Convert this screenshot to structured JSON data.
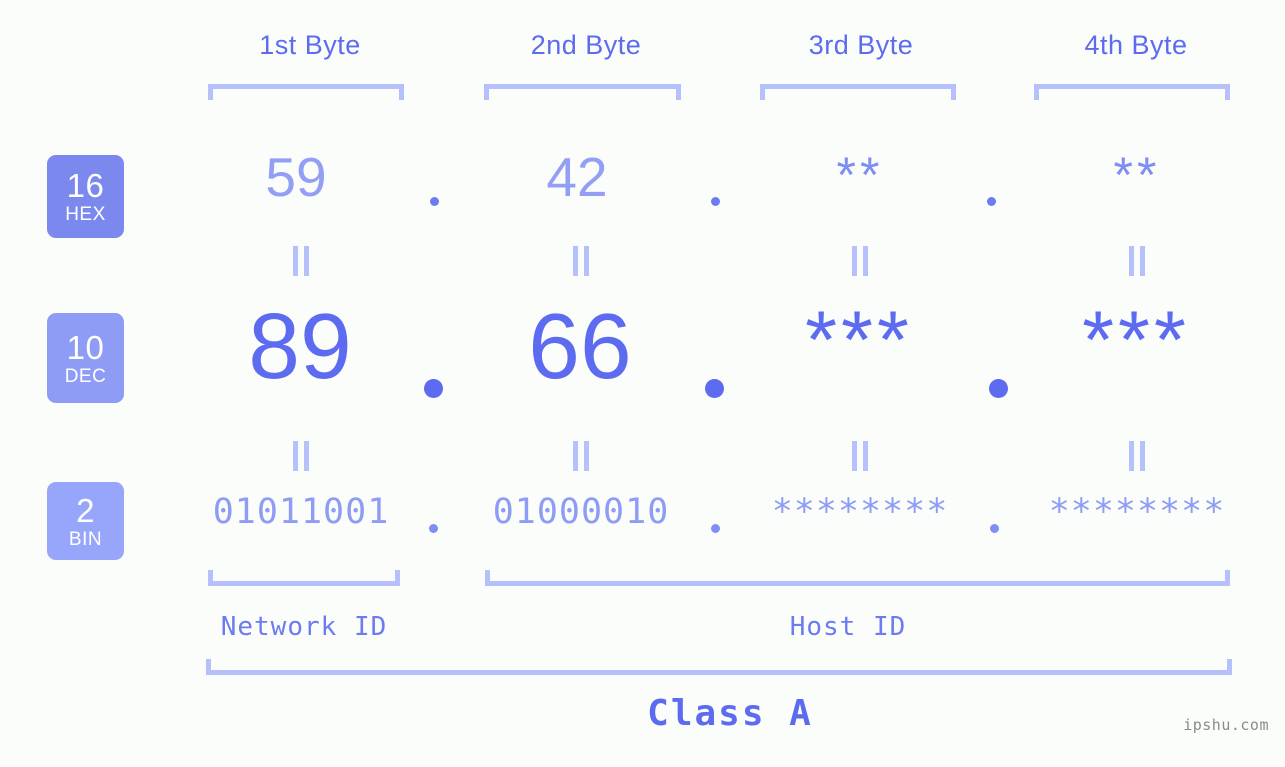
{
  "meta": {
    "watermark": "ipshu.com",
    "background_color": "#fbfdfa",
    "accent_color": "#5c6bf0",
    "bracket_color": "#b6c0fb"
  },
  "headers": {
    "byte1": "1st Byte",
    "byte2": "2nd Byte",
    "byte3": "3rd Byte",
    "byte4": "4th Byte"
  },
  "badges": [
    {
      "number": "16",
      "name": "HEX",
      "color": "#7b89ee"
    },
    {
      "number": "10",
      "name": "DEC",
      "color": "#8e9cf6"
    },
    {
      "number": "2",
      "name": "BIN",
      "color": "#97a6fb"
    }
  ],
  "rows": {
    "hex": {
      "byte1": "59",
      "byte2": "42",
      "byte3": "**",
      "byte4": "**",
      "separator": "."
    },
    "dec": {
      "byte1": "89",
      "byte2": "66",
      "byte3": "***",
      "byte4": "***",
      "separator": "."
    },
    "bin": {
      "byte1": "01011001",
      "byte2": "01000010",
      "byte3": "********",
      "byte4": "********",
      "separator": "."
    }
  },
  "equals": {
    "symbol": "="
  },
  "footer": {
    "network_id": "Network ID",
    "host_id": "Host ID",
    "class": "Class A"
  }
}
